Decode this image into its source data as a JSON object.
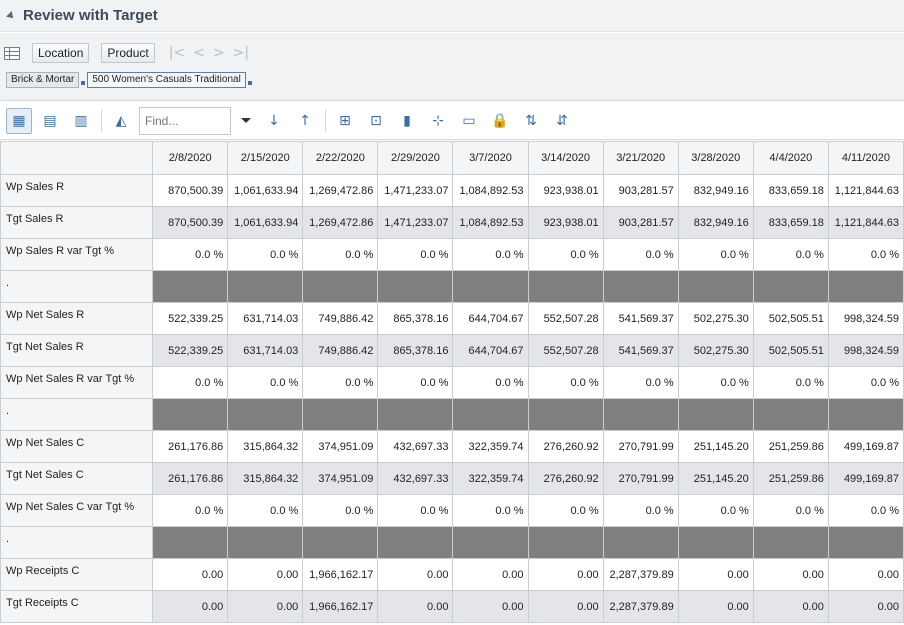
{
  "panel": {
    "title": "Review with Target"
  },
  "dimensions": {
    "buttons": [
      "Location",
      "Product"
    ],
    "breadcrumbs": [
      "Brick & Mortar",
      "500 Women's Casuals Traditional"
    ]
  },
  "toolbar": {
    "find_placeholder": "Find..."
  },
  "grid": {
    "columns": [
      "2/8/2020",
      "2/15/2020",
      "2/22/2020",
      "2/29/2020",
      "3/7/2020",
      "3/14/2020",
      "3/21/2020",
      "3/28/2020",
      "4/4/2020",
      "4/11/2020"
    ],
    "rows": [
      {
        "label": "Wp Sales R",
        "kind": "wp",
        "values": [
          "870,500.39",
          "1,061,633.94",
          "1,269,472.86",
          "1,471,233.07",
          "1,084,892.53",
          "923,938.01",
          "903,281.57",
          "832,949.16",
          "833,659.18",
          "1,121,844.63"
        ]
      },
      {
        "label": "Tgt Sales R",
        "kind": "tgt",
        "values": [
          "870,500.39",
          "1,061,633.94",
          "1,269,472.86",
          "1,471,233.07",
          "1,084,892.53",
          "923,938.01",
          "903,281.57",
          "832,949.16",
          "833,659.18",
          "1,121,844.63"
        ]
      },
      {
        "label": "Wp Sales R var Tgt %",
        "kind": "wp",
        "values": [
          "0.0 %",
          "0.0 %",
          "0.0 %",
          "0.0 %",
          "0.0 %",
          "0.0 %",
          "0.0 %",
          "0.0 %",
          "0.0 %",
          "0.0 %"
        ]
      },
      {
        "label": ".",
        "kind": "blank",
        "values": [
          "",
          "",
          "",
          "",
          "",
          "",
          "",
          "",
          "",
          ""
        ]
      },
      {
        "label": "Wp Net Sales R",
        "kind": "wp",
        "values": [
          "522,339.25",
          "631,714.03",
          "749,886.42",
          "865,378.16",
          "644,704.67",
          "552,507.28",
          "541,569.37",
          "502,275.30",
          "502,505.51",
          "998,324.59"
        ]
      },
      {
        "label": "Tgt Net Sales R",
        "kind": "tgt",
        "values": [
          "522,339.25",
          "631,714.03",
          "749,886.42",
          "865,378.16",
          "644,704.67",
          "552,507.28",
          "541,569.37",
          "502,275.30",
          "502,505.51",
          "998,324.59"
        ]
      },
      {
        "label": "Wp Net Sales R var Tgt %",
        "kind": "wp",
        "values": [
          "0.0 %",
          "0.0 %",
          "0.0 %",
          "0.0 %",
          "0.0 %",
          "0.0 %",
          "0.0 %",
          "0.0 %",
          "0.0 %",
          "0.0 %"
        ]
      },
      {
        "label": ".",
        "kind": "blank",
        "values": [
          "",
          "",
          "",
          "",
          "",
          "",
          "",
          "",
          "",
          ""
        ]
      },
      {
        "label": "Wp Net Sales C",
        "kind": "wp",
        "values": [
          "261,176.86",
          "315,864.32",
          "374,951.09",
          "432,697.33",
          "322,359.74",
          "276,260.92",
          "270,791.99",
          "251,145.20",
          "251,259.86",
          "499,169.87"
        ]
      },
      {
        "label": "Tgt Net Sales C",
        "kind": "tgt",
        "values": [
          "261,176.86",
          "315,864.32",
          "374,951.09",
          "432,697.33",
          "322,359.74",
          "276,260.92",
          "270,791.99",
          "251,145.20",
          "251,259.86",
          "499,169.87"
        ]
      },
      {
        "label": "Wp Net Sales C var Tgt %",
        "kind": "wp",
        "values": [
          "0.0 %",
          "0.0 %",
          "0.0 %",
          "0.0 %",
          "0.0 %",
          "0.0 %",
          "0.0 %",
          "0.0 %",
          "0.0 %",
          "0.0 %"
        ]
      },
      {
        "label": ".",
        "kind": "blank",
        "values": [
          "",
          "",
          "",
          "",
          "",
          "",
          "",
          "",
          "",
          ""
        ]
      },
      {
        "label": "Wp Receipts C",
        "kind": "wp",
        "values": [
          "0.00",
          "0.00",
          "1,966,162.17",
          "0.00",
          "0.00",
          "0.00",
          "2,287,379.89",
          "0.00",
          "0.00",
          "0.00"
        ]
      },
      {
        "label": "Tgt Receipts C",
        "kind": "tgt",
        "values": [
          "0.00",
          "0.00",
          "1,966,162.17",
          "0.00",
          "0.00",
          "0.00",
          "2,287,379.89",
          "0.00",
          "0.00",
          "0.00"
        ]
      }
    ]
  }
}
